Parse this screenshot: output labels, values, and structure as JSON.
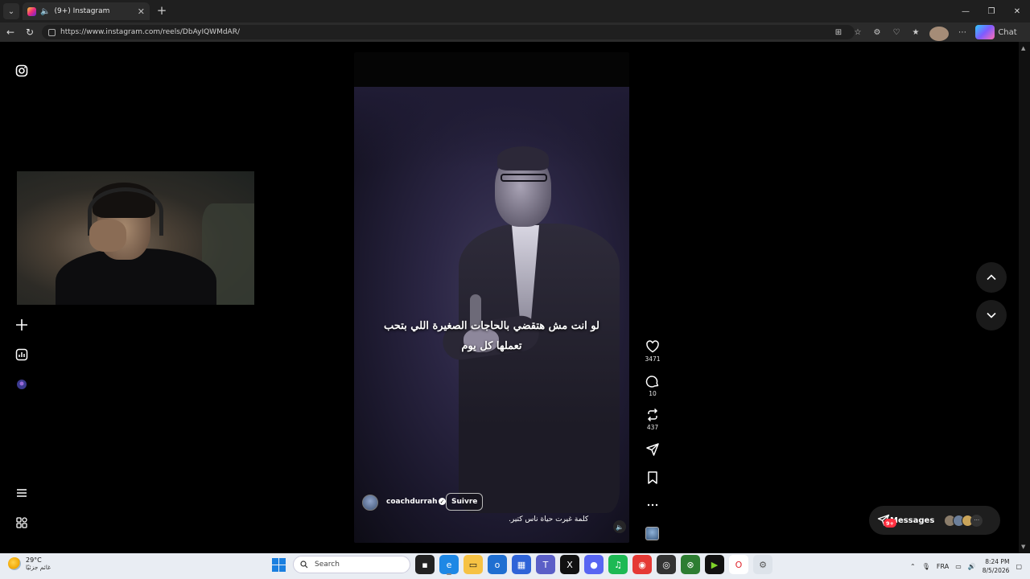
{
  "browser": {
    "tab_title": "(9+) Instagram",
    "url": "https://www.instagram.com/reels/DbAyIQWMdAR/",
    "chat_label": "Chat"
  },
  "reel": {
    "subtitle_line1": "لو انت مش هتقضي بالحاجات الصغيرة اللي بتحب",
    "subtitle_line2": "تعملها كل يوم",
    "author": "coachdurrah",
    "follow_label": "Suivre",
    "caption": "كلمة غيرت حياة ناس كتير.",
    "likes": "3471",
    "comments": "10",
    "reposts": "437"
  },
  "messages": {
    "label": "Messages",
    "badge": "9+"
  },
  "taskbar": {
    "weather_temp": "29°C",
    "weather_desc": "غائم جزئيًا",
    "search_placeholder": "Search",
    "lang": "FRA",
    "time": "8:24 PM",
    "date": "8/5/2026"
  },
  "colors": {
    "accent_red": "#ff3040",
    "browser_bg": "#1f1f1f",
    "taskbar_bg": "#e9edf3"
  }
}
